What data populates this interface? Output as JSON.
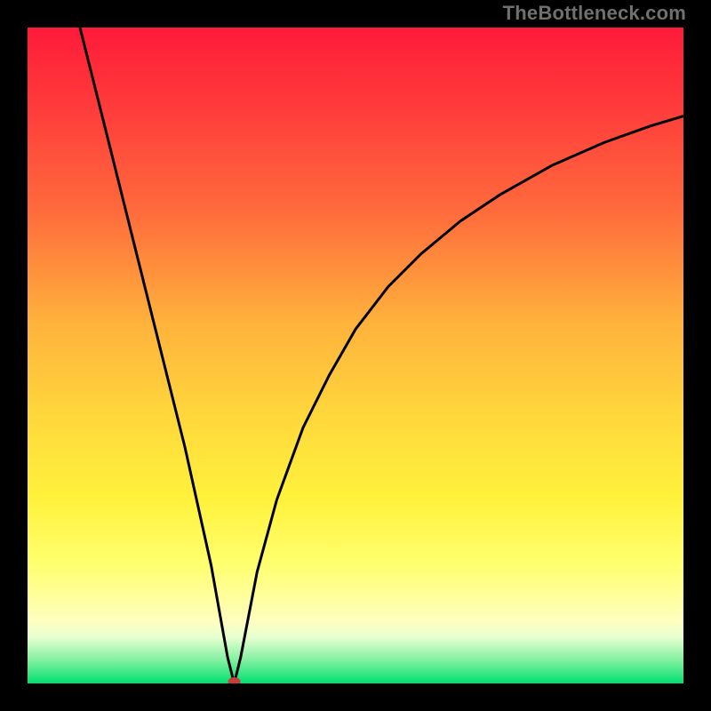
{
  "watermark": "TheBottleneck.com",
  "colors": {
    "frame": "#000000",
    "curve": "#000000",
    "marker": "#C83C3C",
    "gradient_stops": [
      {
        "offset": 0.0,
        "color": "#FF1A3A"
      },
      {
        "offset": 0.12,
        "color": "#FF3B3B"
      },
      {
        "offset": 0.28,
        "color": "#FF6B3C"
      },
      {
        "offset": 0.45,
        "color": "#FFB23C"
      },
      {
        "offset": 0.6,
        "color": "#FFD93C"
      },
      {
        "offset": 0.72,
        "color": "#FFF23C"
      },
      {
        "offset": 0.82,
        "color": "#FFFF70"
      },
      {
        "offset": 0.905,
        "color": "#FFFFC0"
      },
      {
        "offset": 0.93,
        "color": "#E6FFD0"
      },
      {
        "offset": 0.965,
        "color": "#80F0A0"
      },
      {
        "offset": 1.0,
        "color": "#00E070"
      }
    ]
  },
  "chart_data": {
    "type": "line",
    "title": "",
    "xlabel": "",
    "ylabel": "",
    "xlim": [
      0,
      1
    ],
    "ylim": [
      0,
      1
    ],
    "marker": {
      "x": 0.315,
      "y": 0.0
    },
    "series": [
      {
        "name": "curve",
        "x": [
          0.08,
          0.12,
          0.16,
          0.2,
          0.24,
          0.28,
          0.305,
          0.315,
          0.325,
          0.35,
          0.38,
          0.42,
          0.46,
          0.5,
          0.55,
          0.6,
          0.66,
          0.72,
          0.8,
          0.88,
          0.95,
          1.0
        ],
        "y": [
          1.0,
          0.84,
          0.68,
          0.52,
          0.36,
          0.18,
          0.04,
          0.0,
          0.04,
          0.17,
          0.28,
          0.39,
          0.47,
          0.54,
          0.605,
          0.655,
          0.705,
          0.745,
          0.79,
          0.825,
          0.85,
          0.865
        ]
      }
    ]
  }
}
